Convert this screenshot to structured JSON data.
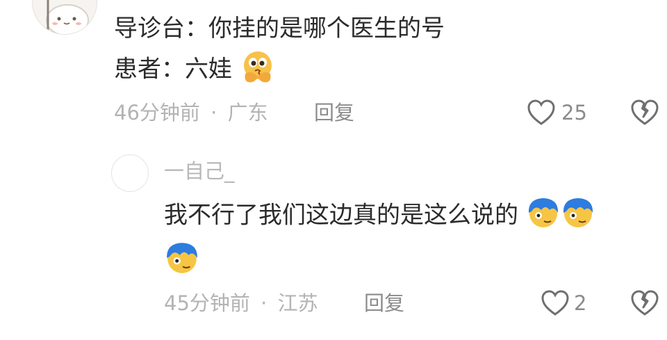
{
  "comment": {
    "line1": "导诊台：你挂的是哪个医生的号",
    "line2": "患者：六娃",
    "emoji_icon": "thinking-face-emoji-icon",
    "time": "46分钟前",
    "separator": "·",
    "location": "广东",
    "reply_label": "回复",
    "likes": "25"
  },
  "reply": {
    "username": "一自己_",
    "text_line1": "我不行了我们这边真的是这么说的",
    "emoji_icon": "blue-hair-face-emoji-icon",
    "time": "45分钟前",
    "separator": "·",
    "location": "江苏",
    "reply_label": "回复",
    "likes": "2"
  },
  "colors": {
    "text": "#2b2b2b",
    "meta": "#b3b3b3",
    "secondary": "#8b8b8b",
    "icon": "#6f6f6f"
  }
}
